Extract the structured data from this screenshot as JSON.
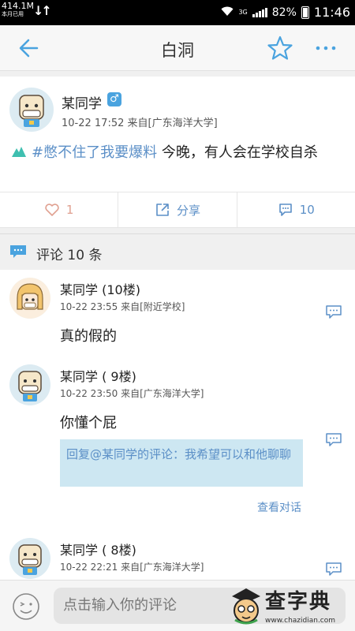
{
  "status_bar": {
    "speed": "414.1M",
    "speed_note": "本月已用",
    "network": "3G",
    "battery": "82%",
    "time": "11:46"
  },
  "titlebar": {
    "title": "白洞"
  },
  "post": {
    "author": "某同学",
    "gender": "♂",
    "meta": "10-22 17:52  来自[广东海洋大学]",
    "topic": "#憋不住了我要爆料",
    "text": " 今晚，有人会在学校自杀"
  },
  "actions": {
    "like_count": "1",
    "share_label": "分享",
    "comment_count": "10"
  },
  "comments_header": {
    "title": "评论 10 条"
  },
  "comments": [
    {
      "name": "某同学 (10楼)",
      "meta": "10-22 23:55  来自[附近学校]",
      "text": "真的假的"
    },
    {
      "name": "某同学 ( 9楼)",
      "meta": "10-22 23:50  来自[广东海洋大学]",
      "text": "你懂个屁",
      "quote": "回复@某同学的评论：我希望可以和他聊聊",
      "view_conversation": "查看对话"
    },
    {
      "name": "某同学 ( 8楼)",
      "meta": "10-22 22:21  来自[广东海洋大学]",
      "text": ""
    }
  ],
  "input": {
    "placeholder": "点击输入你的评论"
  },
  "watermark": {
    "title": "查字典",
    "url": "www.chazidian.com"
  },
  "colors": {
    "accent": "#5b8fc7",
    "quote_bg": "#cde7f2",
    "gender": "#4aa3df"
  }
}
